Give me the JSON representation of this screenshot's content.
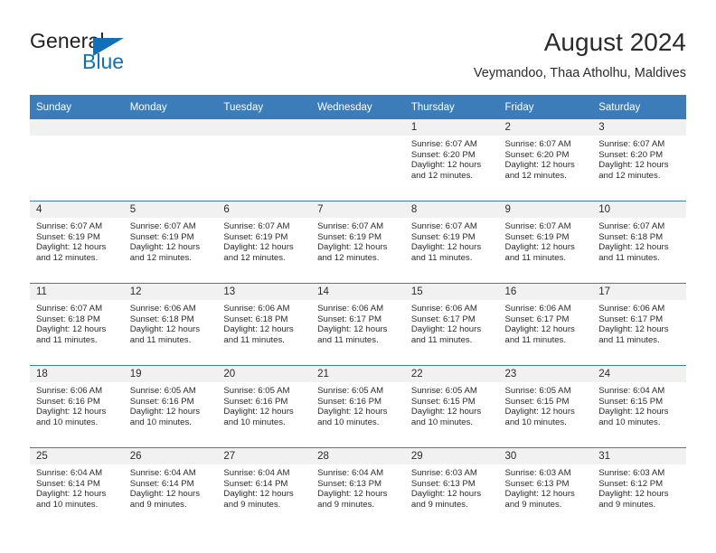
{
  "brand": {
    "name_top": "General",
    "name_bottom": "Blue",
    "triangle_color": "#1270bb",
    "text_color": "#231f20"
  },
  "header": {
    "title": "August 2024",
    "subtitle": "Veymandoo, Thaa Atholhu, Maldives"
  },
  "theme": {
    "header_row_bg": "#3b7cb9",
    "header_row_text": "#ffffff",
    "daynum_bg": "#f1f1f1",
    "cell_bg": "#ffffff",
    "text": "#2b2b2b"
  },
  "weekdays": [
    "Sunday",
    "Monday",
    "Tuesday",
    "Wednesday",
    "Thursday",
    "Friday",
    "Saturday"
  ],
  "weeks": [
    [
      {
        "day": "",
        "sunrise": "",
        "sunset": "",
        "daylight": ""
      },
      {
        "day": "",
        "sunrise": "",
        "sunset": "",
        "daylight": ""
      },
      {
        "day": "",
        "sunrise": "",
        "sunset": "",
        "daylight": ""
      },
      {
        "day": "",
        "sunrise": "",
        "sunset": "",
        "daylight": ""
      },
      {
        "day": "1",
        "sunrise": "Sunrise: 6:07 AM",
        "sunset": "Sunset: 6:20 PM",
        "daylight": "Daylight: 12 hours and 12 minutes."
      },
      {
        "day": "2",
        "sunrise": "Sunrise: 6:07 AM",
        "sunset": "Sunset: 6:20 PM",
        "daylight": "Daylight: 12 hours and 12 minutes."
      },
      {
        "day": "3",
        "sunrise": "Sunrise: 6:07 AM",
        "sunset": "Sunset: 6:20 PM",
        "daylight": "Daylight: 12 hours and 12 minutes."
      }
    ],
    [
      {
        "day": "4",
        "sunrise": "Sunrise: 6:07 AM",
        "sunset": "Sunset: 6:19 PM",
        "daylight": "Daylight: 12 hours and 12 minutes."
      },
      {
        "day": "5",
        "sunrise": "Sunrise: 6:07 AM",
        "sunset": "Sunset: 6:19 PM",
        "daylight": "Daylight: 12 hours and 12 minutes."
      },
      {
        "day": "6",
        "sunrise": "Sunrise: 6:07 AM",
        "sunset": "Sunset: 6:19 PM",
        "daylight": "Daylight: 12 hours and 12 minutes."
      },
      {
        "day": "7",
        "sunrise": "Sunrise: 6:07 AM",
        "sunset": "Sunset: 6:19 PM",
        "daylight": "Daylight: 12 hours and 12 minutes."
      },
      {
        "day": "8",
        "sunrise": "Sunrise: 6:07 AM",
        "sunset": "Sunset: 6:19 PM",
        "daylight": "Daylight: 12 hours and 11 minutes."
      },
      {
        "day": "9",
        "sunrise": "Sunrise: 6:07 AM",
        "sunset": "Sunset: 6:19 PM",
        "daylight": "Daylight: 12 hours and 11 minutes."
      },
      {
        "day": "10",
        "sunrise": "Sunrise: 6:07 AM",
        "sunset": "Sunset: 6:18 PM",
        "daylight": "Daylight: 12 hours and 11 minutes."
      }
    ],
    [
      {
        "day": "11",
        "sunrise": "Sunrise: 6:07 AM",
        "sunset": "Sunset: 6:18 PM",
        "daylight": "Daylight: 12 hours and 11 minutes."
      },
      {
        "day": "12",
        "sunrise": "Sunrise: 6:06 AM",
        "sunset": "Sunset: 6:18 PM",
        "daylight": "Daylight: 12 hours and 11 minutes."
      },
      {
        "day": "13",
        "sunrise": "Sunrise: 6:06 AM",
        "sunset": "Sunset: 6:18 PM",
        "daylight": "Daylight: 12 hours and 11 minutes."
      },
      {
        "day": "14",
        "sunrise": "Sunrise: 6:06 AM",
        "sunset": "Sunset: 6:17 PM",
        "daylight": "Daylight: 12 hours and 11 minutes."
      },
      {
        "day": "15",
        "sunrise": "Sunrise: 6:06 AM",
        "sunset": "Sunset: 6:17 PM",
        "daylight": "Daylight: 12 hours and 11 minutes."
      },
      {
        "day": "16",
        "sunrise": "Sunrise: 6:06 AM",
        "sunset": "Sunset: 6:17 PM",
        "daylight": "Daylight: 12 hours and 11 minutes."
      },
      {
        "day": "17",
        "sunrise": "Sunrise: 6:06 AM",
        "sunset": "Sunset: 6:17 PM",
        "daylight": "Daylight: 12 hours and 11 minutes."
      }
    ],
    [
      {
        "day": "18",
        "sunrise": "Sunrise: 6:06 AM",
        "sunset": "Sunset: 6:16 PM",
        "daylight": "Daylight: 12 hours and 10 minutes."
      },
      {
        "day": "19",
        "sunrise": "Sunrise: 6:05 AM",
        "sunset": "Sunset: 6:16 PM",
        "daylight": "Daylight: 12 hours and 10 minutes."
      },
      {
        "day": "20",
        "sunrise": "Sunrise: 6:05 AM",
        "sunset": "Sunset: 6:16 PM",
        "daylight": "Daylight: 12 hours and 10 minutes."
      },
      {
        "day": "21",
        "sunrise": "Sunrise: 6:05 AM",
        "sunset": "Sunset: 6:16 PM",
        "daylight": "Daylight: 12 hours and 10 minutes."
      },
      {
        "day": "22",
        "sunrise": "Sunrise: 6:05 AM",
        "sunset": "Sunset: 6:15 PM",
        "daylight": "Daylight: 12 hours and 10 minutes."
      },
      {
        "day": "23",
        "sunrise": "Sunrise: 6:05 AM",
        "sunset": "Sunset: 6:15 PM",
        "daylight": "Daylight: 12 hours and 10 minutes."
      },
      {
        "day": "24",
        "sunrise": "Sunrise: 6:04 AM",
        "sunset": "Sunset: 6:15 PM",
        "daylight": "Daylight: 12 hours and 10 minutes."
      }
    ],
    [
      {
        "day": "25",
        "sunrise": "Sunrise: 6:04 AM",
        "sunset": "Sunset: 6:14 PM",
        "daylight": "Daylight: 12 hours and 10 minutes."
      },
      {
        "day": "26",
        "sunrise": "Sunrise: 6:04 AM",
        "sunset": "Sunset: 6:14 PM",
        "daylight": "Daylight: 12 hours and 9 minutes."
      },
      {
        "day": "27",
        "sunrise": "Sunrise: 6:04 AM",
        "sunset": "Sunset: 6:14 PM",
        "daylight": "Daylight: 12 hours and 9 minutes."
      },
      {
        "day": "28",
        "sunrise": "Sunrise: 6:04 AM",
        "sunset": "Sunset: 6:13 PM",
        "daylight": "Daylight: 12 hours and 9 minutes."
      },
      {
        "day": "29",
        "sunrise": "Sunrise: 6:03 AM",
        "sunset": "Sunset: 6:13 PM",
        "daylight": "Daylight: 12 hours and 9 minutes."
      },
      {
        "day": "30",
        "sunrise": "Sunrise: 6:03 AM",
        "sunset": "Sunset: 6:13 PM",
        "daylight": "Daylight: 12 hours and 9 minutes."
      },
      {
        "day": "31",
        "sunrise": "Sunrise: 6:03 AM",
        "sunset": "Sunset: 6:12 PM",
        "daylight": "Daylight: 12 hours and 9 minutes."
      }
    ]
  ]
}
